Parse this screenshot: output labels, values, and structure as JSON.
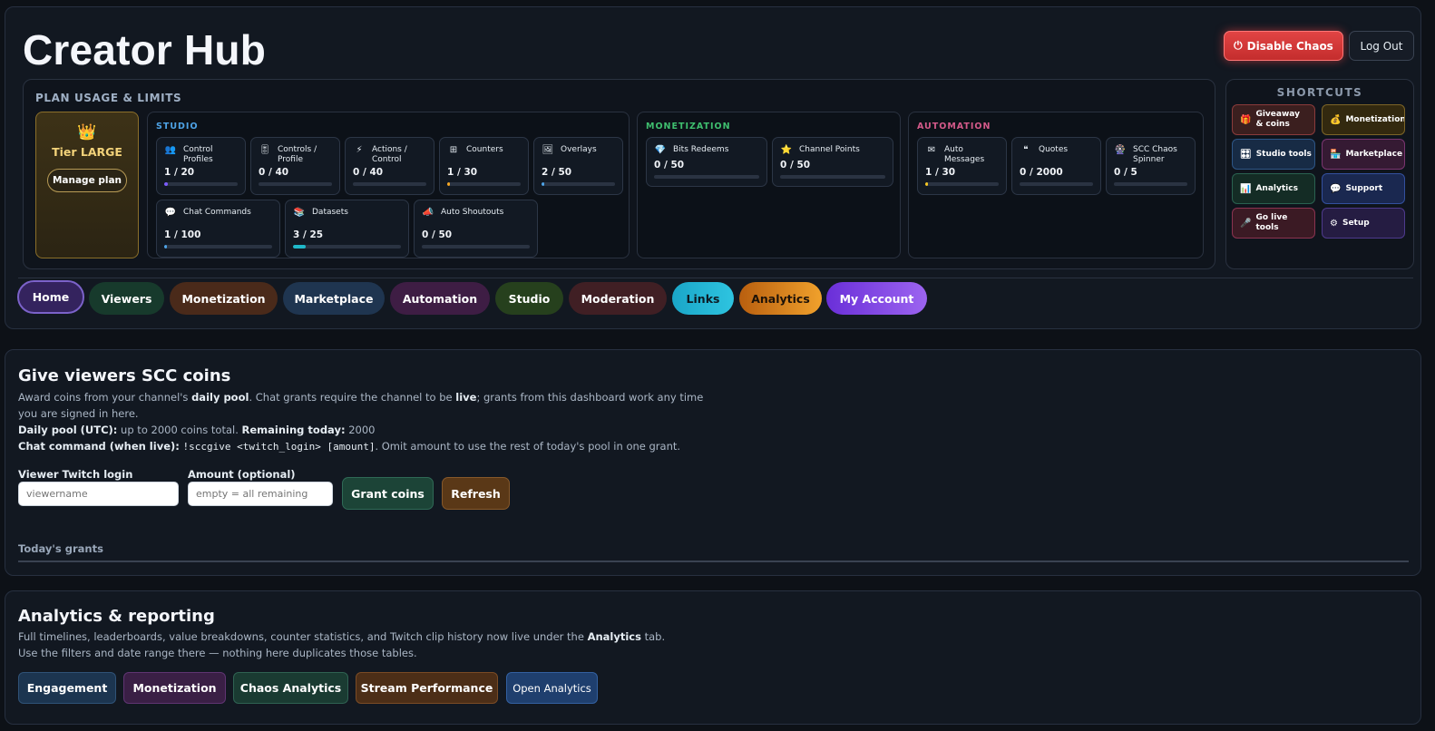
{
  "header": {
    "title": "Creator Hub",
    "disable_chaos_icon": "power-icon",
    "disable_chaos_label": "Disable Chaos",
    "logout_label": "Log Out"
  },
  "plan_usage": {
    "title": "PLAN USAGE & LIMITS",
    "tier": {
      "icon": "crown-icon",
      "name": "Tier LARGE",
      "manage_label": "Manage plan"
    },
    "groups": [
      {
        "label": "STUDIO",
        "color": "#4ea3e6",
        "items": [
          {
            "icon": "👥",
            "label": "Control Profiles",
            "value": "1 / 20",
            "fraction": 0.05,
            "color": "#7c5cff"
          },
          {
            "icon": "🎚",
            "label": "Controls / Profile",
            "value": "0 / 40",
            "fraction": 0,
            "color": "#4ea3e6"
          },
          {
            "icon": "⚡",
            "label": "Actions / Control",
            "value": "0 / 40",
            "fraction": 0,
            "color": "#f5a623"
          },
          {
            "icon": "⊞",
            "label": "Counters",
            "value": "1 / 30",
            "fraction": 0.033,
            "color": "#f5a623"
          },
          {
            "icon": "🖼",
            "label": "Overlays",
            "value": "2 / 50",
            "fraction": 0.04,
            "color": "#4ea3e6"
          },
          {
            "icon": "💬",
            "label": "Chat Commands",
            "value": "1 / 100",
            "fraction": 0.01,
            "color": "#4ea3e6"
          },
          {
            "icon": "📚",
            "label": "Datasets",
            "value": "3 / 25",
            "fraction": 0.12,
            "color": "#1fb8c9"
          },
          {
            "icon": "📣",
            "label": "Auto Shoutouts",
            "value": "0 / 50",
            "fraction": 0,
            "color": "#4ea3e6"
          }
        ]
      },
      {
        "label": "MONETIZATION",
        "color": "#3fbf6f",
        "items": [
          {
            "icon": "💎",
            "label": "Bits Redeems",
            "value": "0 / 50",
            "fraction": 0,
            "color": "#4ea3e6"
          },
          {
            "icon": "⭐",
            "label": "Channel Points",
            "value": "0 / 50",
            "fraction": 0,
            "color": "#f5a623"
          }
        ]
      },
      {
        "label": "AUTOMATION",
        "color": "#d45a8a",
        "items": [
          {
            "icon": "✉",
            "label": "Auto Messages",
            "value": "1 / 30",
            "fraction": 0.033,
            "color": "#f5c623"
          },
          {
            "icon": "❝",
            "label": "Quotes",
            "value": "0 / 2000",
            "fraction": 0,
            "color": "#4ea3e6"
          },
          {
            "icon": "🎡",
            "label": "SCC Chaos Spinner",
            "value": "0 / 5",
            "fraction": 0,
            "color": "#4ea3e6"
          }
        ]
      }
    ]
  },
  "shortcuts": {
    "title": "SHORTCUTS",
    "items": [
      {
        "icon": "🎁",
        "label": "Giveaway & coins"
      },
      {
        "icon": "💰",
        "label": "Monetization"
      },
      {
        "icon": "🎛",
        "label": "Studio tools"
      },
      {
        "icon": "🏪",
        "label": "Marketplace"
      },
      {
        "icon": "📊",
        "label": "Analytics"
      },
      {
        "icon": "💬",
        "label": "Support"
      },
      {
        "icon": "🎤",
        "label": "Go live tools"
      },
      {
        "icon": "⚙",
        "label": "Setup"
      }
    ]
  },
  "nav_tabs": [
    "Home",
    "Viewers",
    "Monetization",
    "Marketplace",
    "Automation",
    "Studio",
    "Moderation",
    "Links",
    "Analytics",
    "My Account"
  ],
  "grant": {
    "title": "Give viewers SCC coins",
    "line1_a": "Award coins from your channel's ",
    "line1_b": "daily pool",
    "line1_c": ". Chat grants require the channel to be ",
    "line1_d": "live",
    "line1_e": "; grants from this dashboard work any time you are signed in here.",
    "pool_label": "Daily pool (UTC):",
    "pool_text": " up to 2000 coins total. ",
    "remaining_label": "Remaining today:",
    "remaining_value": " 2000",
    "cmd_label": "Chat command (when live):",
    "cmd_code": "!sccgive <twitch_login> [amount]",
    "cmd_text": ". Omit amount to use the rest of today's pool in one grant.",
    "login_label": "Viewer Twitch login",
    "login_placeholder": "viewername",
    "amount_label": "Amount (optional)",
    "amount_placeholder": "empty = all remaining",
    "grant_button": "Grant coins",
    "refresh_button": "Refresh",
    "todays_grants": "Today's grants"
  },
  "analytics": {
    "title": "Analytics & reporting",
    "desc_a": "Full timelines, leaderboards, value breakdowns, counter statistics, and Twitch clip history now live under the ",
    "desc_b": "Analytics",
    "desc_c": " tab. Use the filters and date range there — nothing here duplicates those tables.",
    "buttons": [
      "Engagement",
      "Monetization",
      "Chaos Analytics",
      "Stream Performance",
      "Open Analytics"
    ]
  }
}
